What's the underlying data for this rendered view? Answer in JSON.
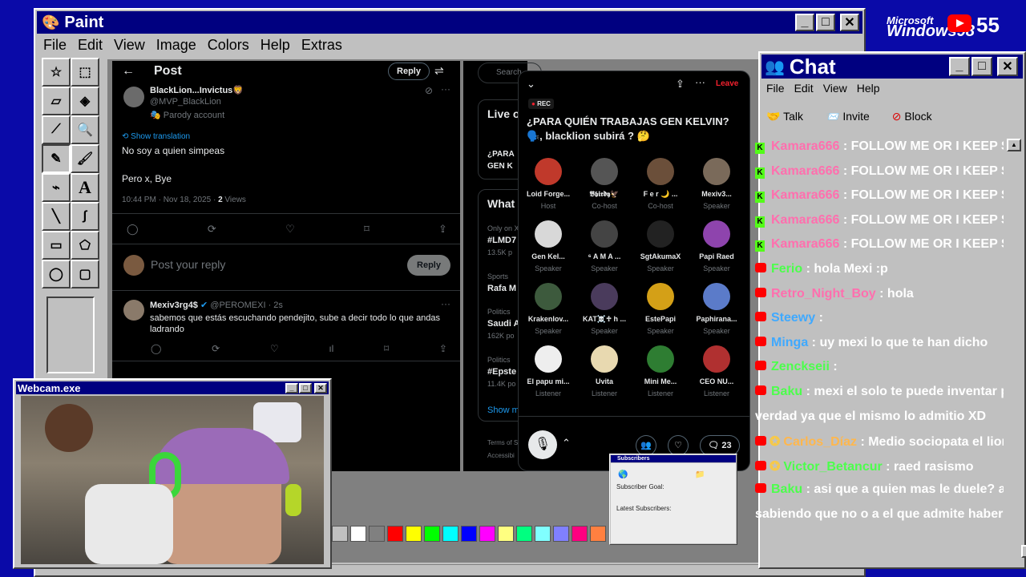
{
  "paint": {
    "title": "Paint",
    "menu": [
      "File",
      "Edit",
      "View",
      "Image",
      "Colors",
      "Help",
      "Extras"
    ]
  },
  "branding": {
    "microsoft": "Microsoft",
    "windows": "Windows98",
    "count": "55"
  },
  "tweet": {
    "header": "Post",
    "reply_btn": "Reply",
    "author": "BlackLion...Invictus🦁",
    "handle": "@MVP_BlackLion",
    "parody": "Parody account",
    "show_translation": "Show translation",
    "line1": "No soy a quien simpeas",
    "line2": "Pero x, Bye",
    "meta_time": "10:44 PM · Nov 18, 2025 · ",
    "views_num": "2",
    "views_label": " Views",
    "compose_placeholder": "Post your reply",
    "compose_reply": "Reply",
    "reply2_author": "Mexiv3rg4$",
    "reply2_handle": "@PEROMEXI · 2s",
    "reply2_text": "sabemos que estás escuchando pendejito, sube a decir todo lo que andas ladrando"
  },
  "sidebar": {
    "search": "Search",
    "live": "Live o",
    "live_sub1": "¿PARA",
    "live_sub2": "GEN K",
    "whats": "What",
    "trend1_ctx": "Only on X",
    "trend1": "#LMD7",
    "trend1_count": "13.5K p",
    "trend2_ctx": "Sports",
    "trend2": "Rafa M",
    "trend3_ctx": "Politics",
    "trend3": "Saudi A",
    "trend3_count": "162K po",
    "trend4_ctx": "Politics",
    "trend4": "#Epste",
    "trend4_count": "11.4K po",
    "show_more": "Show m",
    "terms": "Terms of S",
    "access": "Accessibi"
  },
  "space": {
    "leave": "Leave",
    "rec": "REC",
    "title": "¿PARA QUIÉN TRABAJAS GEN KELVIN? 🗣️, blacklion subirá ? 🤔",
    "participants": [
      {
        "name": "Loid Forge...",
        "role": "Host",
        "color": "#c0392b"
      },
      {
        "name": "𝕭𝖇𝖎𝖗𝖉𝖞🦅",
        "role": "Co-host",
        "color": "#555"
      },
      {
        "name": "F e r 🌙 ...",
        "role": "Co-host",
        "color": "#6b4f3a"
      },
      {
        "name": "Mexiv3...",
        "role": "Speaker",
        "color": "#7a6a5a"
      },
      {
        "name": "Gen Kel...",
        "role": "Speaker",
        "color": "#d8d8d8"
      },
      {
        "name": "⁶ A M A ...",
        "role": "Speaker",
        "color": "#444"
      },
      {
        "name": "SgtAkumaX",
        "role": "Speaker",
        "color": "#222"
      },
      {
        "name": "Papi Raed",
        "role": "Speaker",
        "color": "#8e44ad"
      },
      {
        "name": "Krakenlov...",
        "role": "Speaker",
        "color": "#3d5a3d"
      },
      {
        "name": "KAT☠️♱ h ...",
        "role": "Speaker",
        "color": "#4a3b5c"
      },
      {
        "name": "EstePapi",
        "role": "Speaker",
        "color": "#d4a017"
      },
      {
        "name": "Paphirana...",
        "role": "Speaker",
        "color": "#5b7bc9"
      },
      {
        "name": "El papu mi...",
        "role": "Listener",
        "color": "#eee"
      },
      {
        "name": "Uvita",
        "role": "Listener",
        "color": "#e8d9b0"
      },
      {
        "name": "Mini Me...",
        "role": "Listener",
        "color": "#2e7d32"
      },
      {
        "name": "CEO NU...",
        "role": "Listener",
        "color": "#b03030"
      }
    ],
    "comment_count": "23"
  },
  "subscribers": {
    "title": "Subscribers",
    "goal": "Subscriber Goal:",
    "latest": "Latest Subscribers:"
  },
  "webcam": {
    "title": "Webcam.exe"
  },
  "chat": {
    "title": "Chat",
    "menu": [
      "File",
      "Edit",
      "View",
      "Help"
    ],
    "talk": "Talk",
    "invite": "Invite",
    "block": "Block",
    "messages": [
      {
        "user": "Kamara666",
        "text": ": FOLLOW ME OR I KEEP SPAM",
        "color": "#ff6fae",
        "src": "kick"
      },
      {
        "user": "Kamara666",
        "text": ": FOLLOW ME OR I KEEP SPAM",
        "color": "#ff6fae",
        "src": "kick"
      },
      {
        "user": "Kamara666",
        "text": ": FOLLOW ME OR I KEEP SPAM",
        "color": "#ff6fae",
        "src": "kick"
      },
      {
        "user": "Kamara666",
        "text": ": FOLLOW ME OR I KEEP SPAM",
        "color": "#ff6fae",
        "src": "kick"
      },
      {
        "user": "Kamara666",
        "text": ": FOLLOW ME OR I KEEP SPAM",
        "color": "#ff6fae",
        "src": "kick"
      },
      {
        "user": "Ferio",
        "text": ": hola Mexi :p",
        "color": "#4cff4c",
        "src": "yt"
      },
      {
        "user": "Retro_Night_Boy",
        "text": ": hola",
        "color": "#ff6fae",
        "src": "yt"
      },
      {
        "user": "Steewy",
        "text": ":",
        "color": "#3fa9ff",
        "src": "yt"
      },
      {
        "user": "Minga",
        "text": ": uy mexi lo que te han dicho",
        "color": "#3fa9ff",
        "src": "yt"
      },
      {
        "user": "Zenckseii",
        "text": ":",
        "color": "#4cff4c",
        "src": "yt"
      },
      {
        "user": "Baku",
        "text": ": mexi el solo te puede inventar pende",
        "color": "#4cff4c",
        "src": "yt"
      },
      {
        "user": "",
        "text": "verdad ya que el mismo lo admitio XD",
        "color": "#fff",
        "src": "none"
      },
      {
        "user": "Carlos_Díaz",
        "text": ": Medio sociopata el lion",
        "color": "#ffb74d",
        "src": "ytstar"
      },
      {
        "user": "Victor_Betancur",
        "text": ": raed rasismo",
        "color": "#4cff4c",
        "src": "ytstar"
      },
      {
        "user": "Baku",
        "text": ": asi que a quien mas le duele? a ti qu",
        "color": "#4cff4c",
        "src": "yt"
      },
      {
        "user": "",
        "text": "sabiendo que no o a el que admite haber cogic",
        "color": "#fff",
        "src": "none"
      }
    ]
  },
  "palette": [
    "#c0c0c0",
    "#ffffff",
    "#808080",
    "#ff0000",
    "#ffff00",
    "#00ff00",
    "#00ffff",
    "#0000ff",
    "#ff00ff",
    "#ffff80",
    "#00ff80",
    "#80ffff",
    "#8080ff",
    "#ff0080",
    "#ff8040"
  ]
}
